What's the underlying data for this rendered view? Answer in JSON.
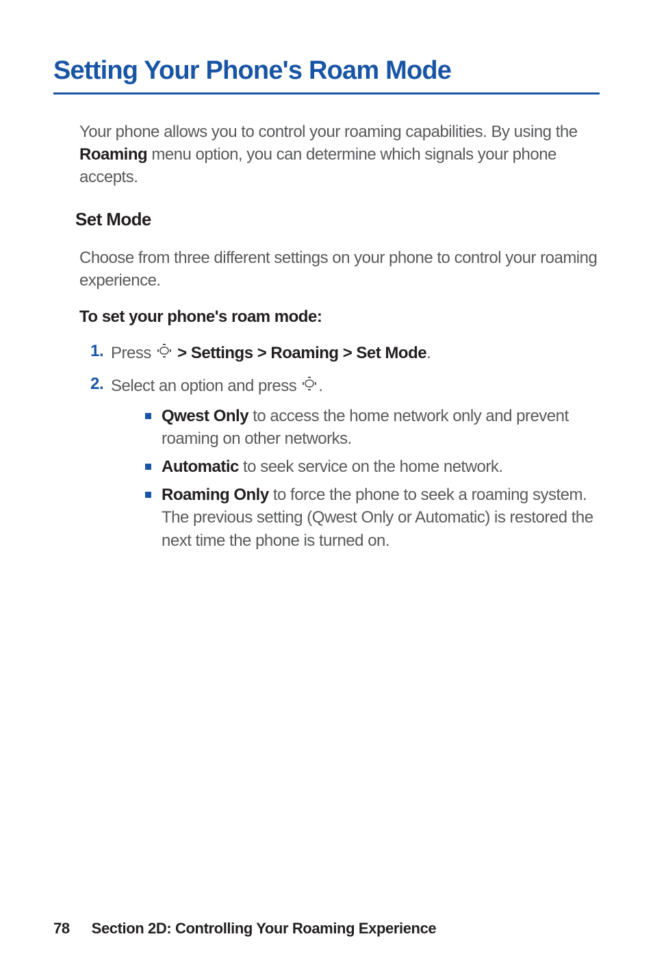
{
  "title": "Setting Your Phone's Roam Mode",
  "intro": {
    "part1": "Your phone allows you to control your roaming capabilities. By using the ",
    "bold": "Roaming",
    "part2": " menu option, you can determine which signals your phone accepts."
  },
  "subheading": "Set Mode",
  "sub_intro": "Choose from three different settings on your phone to control your roaming experience.",
  "instruction_label": "To set your phone's roam mode:",
  "steps": [
    {
      "num": "1.",
      "pre": "Press ",
      "bold": " > Settings > Roaming > Set Mode",
      "post": "."
    },
    {
      "num": "2.",
      "pre": "Select an option and press ",
      "post": ".",
      "bullets": [
        {
          "bold": "Qwest Only",
          "rest": " to access the home network only and prevent roaming on other networks."
        },
        {
          "bold": "Automatic",
          "rest": " to seek service on the home network."
        },
        {
          "bold": "Roaming Only",
          "rest": " to force the phone to seek a roaming system. The previous setting (Qwest Only or Automatic) is restored the next time the phone is turned on."
        }
      ]
    }
  ],
  "footer": {
    "page_num": "78",
    "section": "Section 2D: Controlling Your Roaming Experience"
  }
}
